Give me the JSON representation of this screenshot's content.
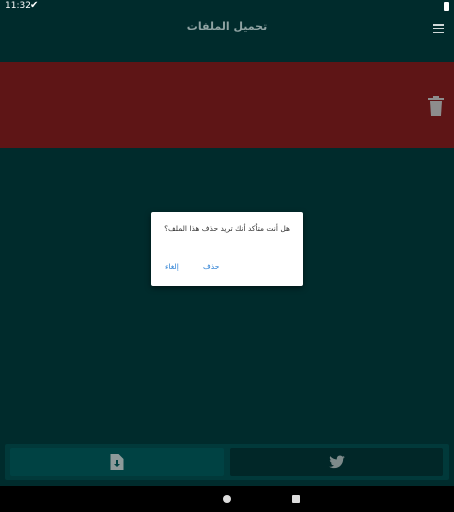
{
  "status_bar": {
    "time": "11:32",
    "check_symbol": "✔"
  },
  "app_bar": {
    "title": "تحميل الملفات"
  },
  "dialog": {
    "message": "هل أنت متأكد أنك تريد حذف هذا الملف؟",
    "cancel_label": "إلغاء",
    "delete_label": "حذف"
  },
  "colors": {
    "background": "#002b2c",
    "file_row": "#5e1516",
    "accent_link": "#2a7fd4"
  },
  "icons": {
    "menu": "menu-icon",
    "trash": "trash-icon",
    "download": "file-download-icon",
    "twitter": "twitter-icon"
  }
}
